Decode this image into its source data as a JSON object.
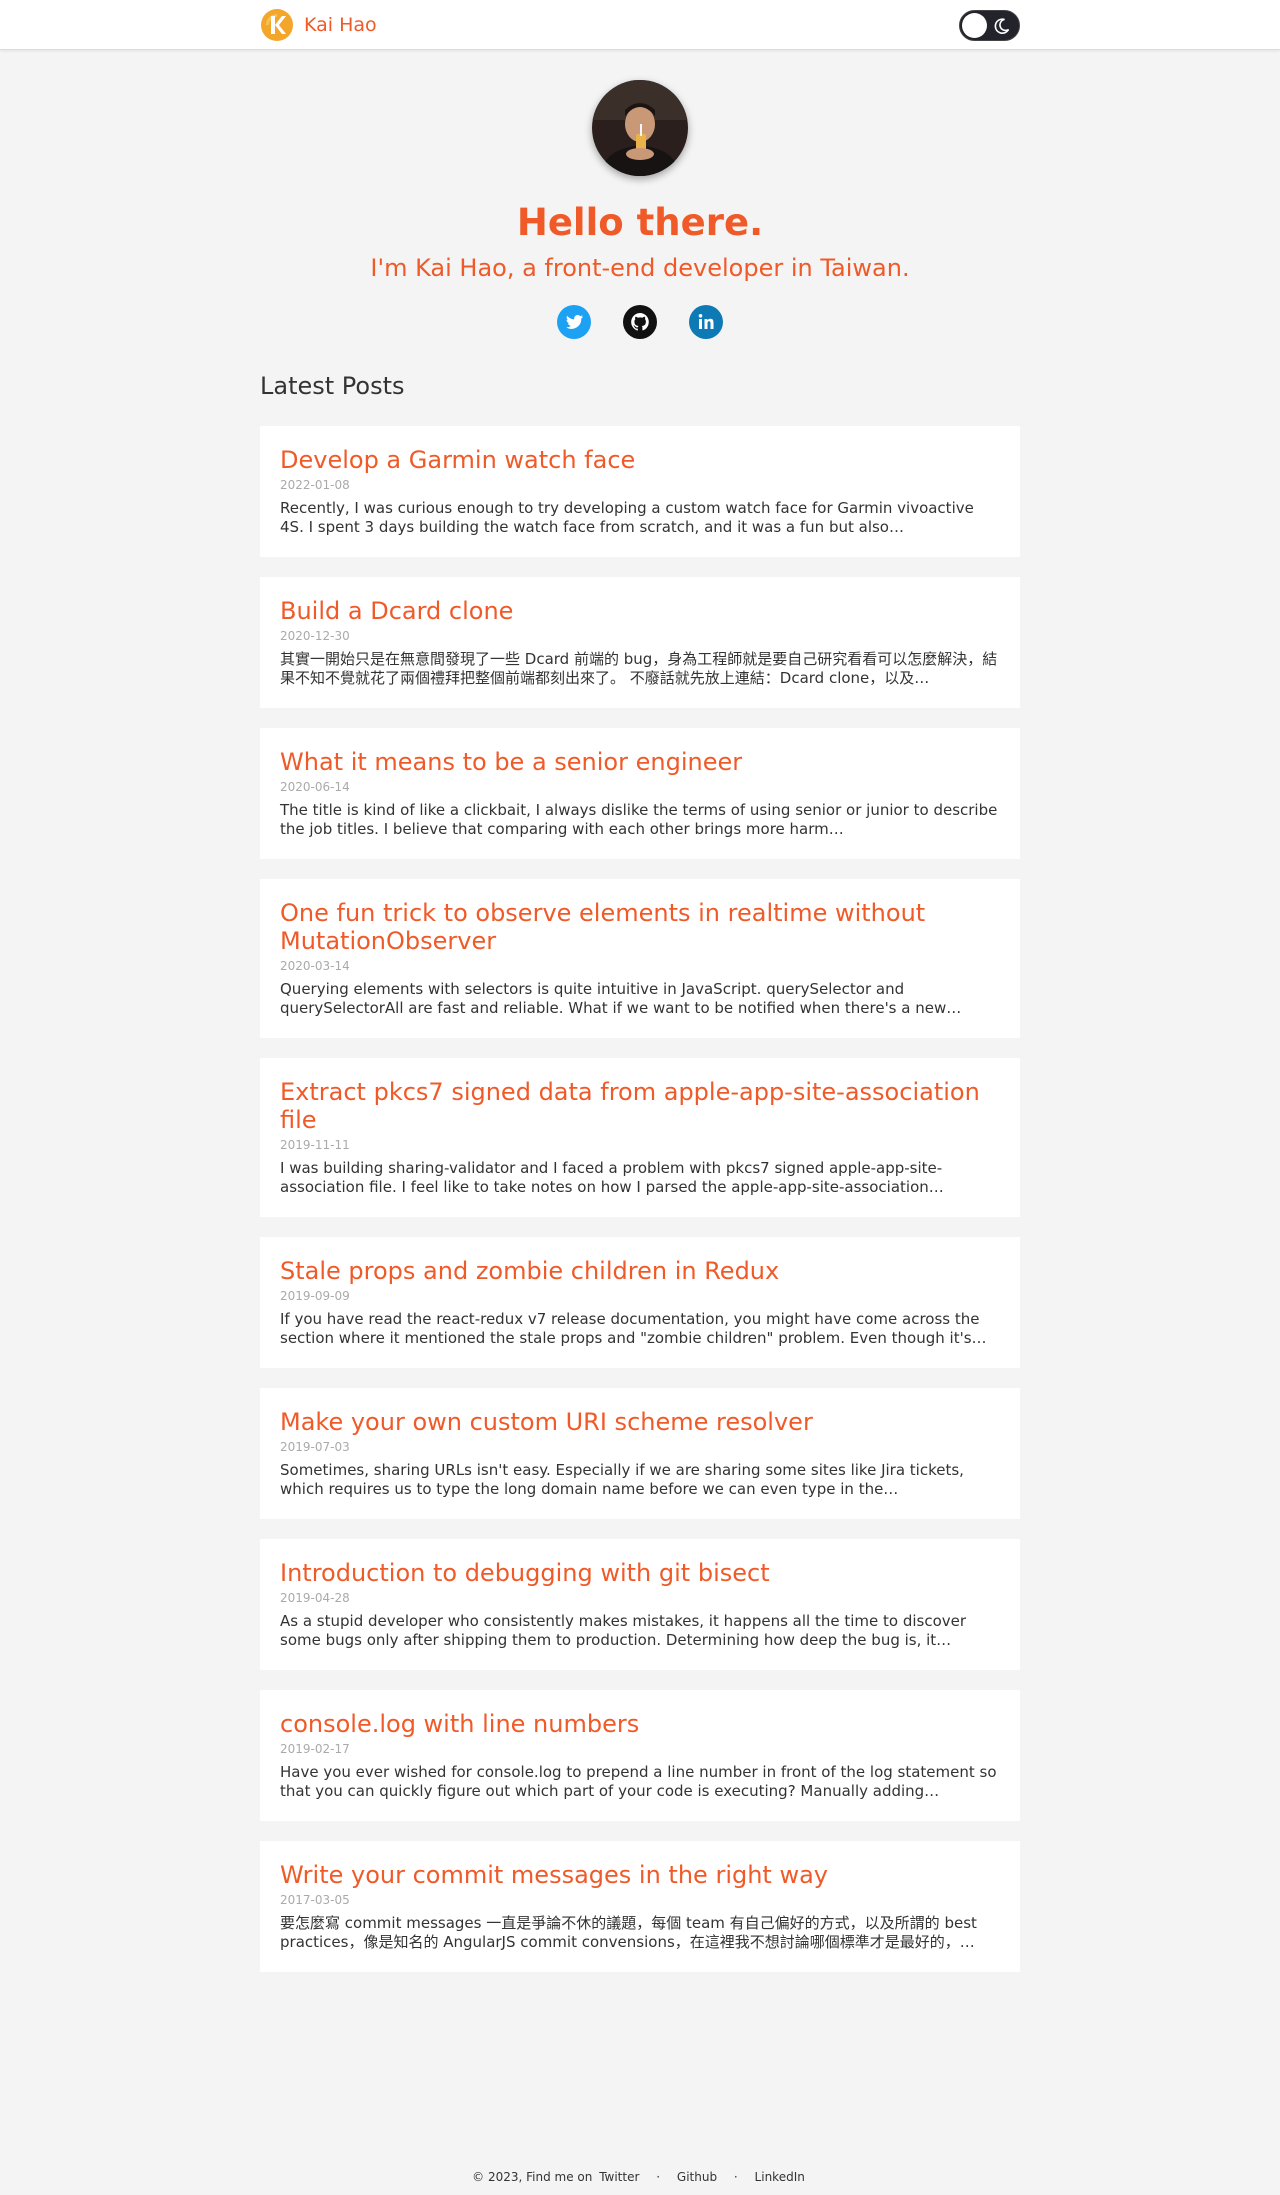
{
  "header": {
    "brand_name": "Kai Hao",
    "theme_toggle": "dark-mode-toggle"
  },
  "hero": {
    "title": "Hello there.",
    "subtitle": "I'm Kai Hao, a front-end developer in Taiwan.",
    "socials": [
      {
        "name": "twitter-icon",
        "color": "#1da1f2"
      },
      {
        "name": "github-icon",
        "color": "#111111"
      },
      {
        "name": "linkedin-icon",
        "color": "#0e7ab5"
      }
    ]
  },
  "latest": {
    "heading": "Latest Posts",
    "posts": [
      {
        "title": "Develop a Garmin watch face",
        "date": "2022-01-08",
        "excerpt": "Recently, I was curious enough to try developing a custom watch face for Garmin vivoactive 4S. I spent 3 days building the watch face from scratch, and it was a fun but also…"
      },
      {
        "title": "Build a Dcard clone",
        "date": "2020-12-30",
        "excerpt": "其實一開始只是在無意間發現了一些 Dcard 前端的 bug，身為工程師就是要自己研究看看可以怎麼解決，結果不知不覺就花了兩個禮拜把整個前端都刻出來了。 不廢話就先放上連結：Dcard clone，以及…"
      },
      {
        "title": "What it means to be a senior engineer",
        "date": "2020-06-14",
        "excerpt": "The title is kind of like a clickbait, I always dislike the terms of using senior or junior to describe the job titles. I believe that comparing with each other brings more harm…"
      },
      {
        "title": "One fun trick to observe elements in realtime without MutationObserver",
        "date": "2020-03-14",
        "excerpt": "Querying elements with selectors is quite intuitive in JavaScript. querySelector and querySelectorAll are fast and reliable. What if we want to be notified when there's a new…"
      },
      {
        "title": "Extract pkcs7 signed data from apple-app-site-association file",
        "date": "2019-11-11",
        "excerpt": "I was building sharing-validator and I faced a problem with pkcs7 signed apple-app-site-association file. I feel like to take notes on how I parsed the apple-app-site-association…"
      },
      {
        "title": "Stale props and zombie children in Redux",
        "date": "2019-09-09",
        "excerpt": "If you have read the react-redux v7 release documentation, you might have come across the section where it mentioned the stale props and \"zombie children\" problem. Even though it's…"
      },
      {
        "title": "Make your own custom URI scheme resolver",
        "date": "2019-07-03",
        "excerpt": "Sometimes, sharing URLs isn't easy. Especially if we are sharing some sites like Jira tickets, which requires us to type the long domain name before we can even type in the…"
      },
      {
        "title": "Introduction to debugging with git bisect",
        "date": "2019-04-28",
        "excerpt": "As a stupid developer who consistently makes mistakes, it happens all the time to discover some bugs only after shipping them to production. Determining how deep the bug is, it…"
      },
      {
        "title": "console.log with line numbers",
        "date": "2019-02-17",
        "excerpt": "Have you ever wished for console.log to prepend a line number in front of the log statement so that you can quickly figure out which part of your code is executing? Manually adding…"
      },
      {
        "title": "Write your commit messages in the right way",
        "date": "2017-03-05",
        "excerpt": "要怎麼寫 commit messages 一直是爭論不休的議題，每個 team 有自己偏好的方式，以及所謂的 best practices，像是知名的 AngularJS commit convensions，在這裡我不想討論哪個標準才是最好的，…"
      }
    ]
  },
  "footer": {
    "prefix": "© 2023, Find me on",
    "links": [
      "Twitter",
      "Github",
      "LinkedIn"
    ],
    "separator": "·"
  },
  "colors": {
    "accent": "#f05a28",
    "background": "#f4f4f4"
  }
}
